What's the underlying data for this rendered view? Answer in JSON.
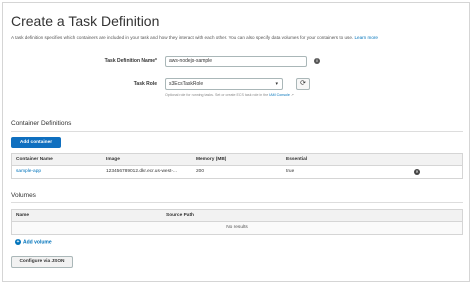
{
  "header": {
    "title": "Create a Task Definition",
    "intro_text": "A task definition specifies which containers are included in your task and how they interact with each other. You can also specify data volumes for your containers to use.",
    "learn_more": "Learn more"
  },
  "form": {
    "task_definition_name_label": "Task Definition Name*",
    "task_definition_name_value": "aws-nodejs-sample",
    "task_role_label": "Task Role",
    "task_role_value": "s3EcsTaskRole",
    "task_role_help": "Optional role for running tasks. Set or create ECS task role in the",
    "task_role_help_link": "IAM Console",
    "info_icon": "info-icon",
    "refresh_icon": "refresh-icon"
  },
  "containers": {
    "section_title": "Container Definitions",
    "add_button": "Add container",
    "columns": [
      "Container Name",
      "Image",
      "Memory (MB)",
      "Essential"
    ],
    "rows": [
      {
        "name": "sample-app",
        "image": "123456789012.dkr.ecr.us-west-...",
        "memory": "200",
        "essential": "true"
      }
    ]
  },
  "volumes": {
    "section_title": "Volumes",
    "columns": [
      "Name",
      "Source Path"
    ],
    "empty_text": "No results",
    "add_link": "Add volume"
  },
  "footer": {
    "configure_json_button": "Configure via JSON"
  },
  "colors": {
    "primary": "#0f6fbf",
    "link": "#0073bb"
  }
}
